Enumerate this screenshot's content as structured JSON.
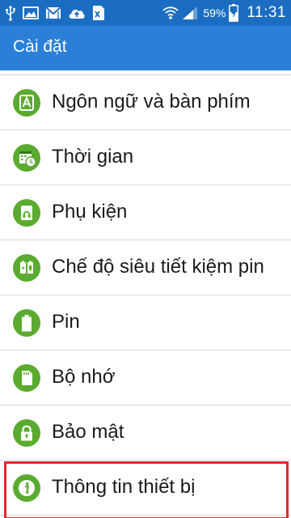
{
  "status_bar": {
    "icons_left": [
      "usb-icon",
      "image-icon",
      "gmail-icon",
      "cloud-upload-icon",
      "excel-file-icon"
    ],
    "icons_right": [
      "wifi-icon",
      "signal-icon",
      "battery-charging-icon"
    ],
    "battery_percent": "59%",
    "time": "11:31",
    "background_color": "#1b6dc1"
  },
  "app_bar": {
    "title": "Cài đặt",
    "background_color": "#2a7fd6"
  },
  "settings_list": {
    "icon_color": "#5aab2f",
    "highlight_color": "#e5262d",
    "items": [
      {
        "label": "Ngôn ngữ và bàn phím",
        "icon": "language-keyboard-icon"
      },
      {
        "label": "Thời gian",
        "icon": "calendar-clock-icon"
      },
      {
        "label": "Phụ kiện",
        "icon": "accessory-icon"
      },
      {
        "label": "Chế độ siêu tiết kiệm pin",
        "icon": "ultra-power-saving-icon"
      },
      {
        "label": "Pin",
        "icon": "battery-icon"
      },
      {
        "label": "Bộ nhớ",
        "icon": "storage-icon"
      },
      {
        "label": "Bảo mật",
        "icon": "lock-icon"
      },
      {
        "label": "Thông tin thiết bị",
        "icon": "info-icon",
        "highlighted": true
      }
    ]
  }
}
